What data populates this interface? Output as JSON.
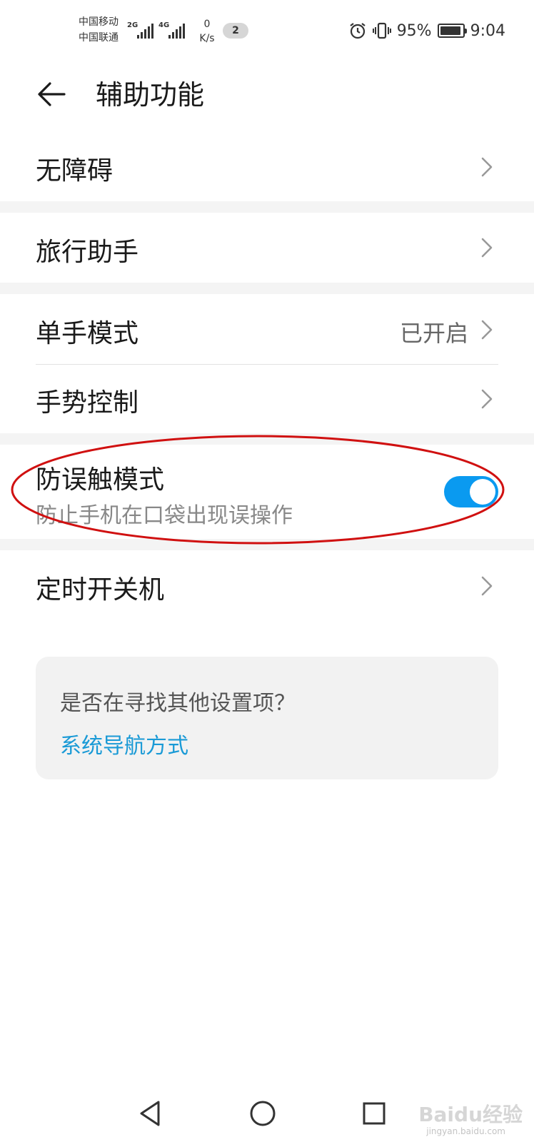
{
  "status_bar": {
    "carrier_1": "中国移动",
    "carrier_2": "中国联通",
    "signal_1_gen": "2G",
    "signal_2_gen": "4G",
    "speed_value": "0",
    "speed_unit": "K/s",
    "notification_count": "2",
    "battery_percent": "95%",
    "battery_level": 0.95,
    "time": "9:04"
  },
  "header": {
    "title": "辅助功能"
  },
  "settings": {
    "accessibility": {
      "label": "无障碍"
    },
    "travel_assistant": {
      "label": "旅行助手"
    },
    "one_hand_mode": {
      "label": "单手模式",
      "value": "已开启"
    },
    "gesture_control": {
      "label": "手势控制"
    },
    "pocket_mode": {
      "label": "防误触模式",
      "description": "防止手机在口袋出现误操作",
      "enabled": true
    },
    "scheduled_power": {
      "label": "定时开关机"
    }
  },
  "suggestion_card": {
    "question": "是否在寻找其他设置项？",
    "link": "系统导航方式"
  },
  "colors": {
    "accent": "#0a9af0",
    "link": "#1a9ad6",
    "annotation": "#d01010"
  },
  "watermark": {
    "brand": "Baidu经验",
    "url": "jingyan.baidu.com"
  }
}
